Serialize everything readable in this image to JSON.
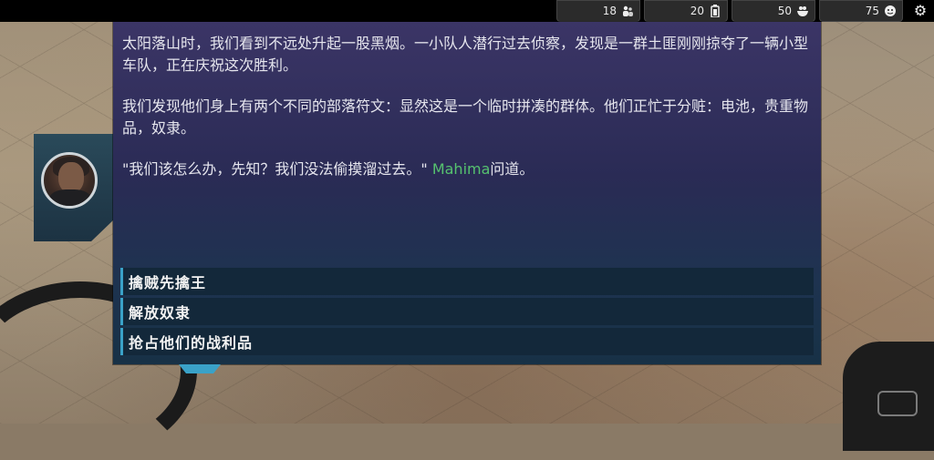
{
  "resources": [
    {
      "value": "18",
      "icon": "people-icon"
    },
    {
      "value": "20",
      "icon": "battery-icon"
    },
    {
      "value": "50",
      "icon": "food-bowl-icon"
    },
    {
      "value": "75",
      "icon": "morale-icon"
    }
  ],
  "story": {
    "paragraph1": "太阳落山时，我们看到不远处升起一股黑烟。一小队人潜行过去侦察，发现是一群土匪刚刚掠夺了一辆小型车队，正在庆祝这次胜利。",
    "paragraph2": "我们发现他们身上有两个不同的部落符文：显然这是一个临时拼凑的群体。他们正忙于分赃：电池，贵重物品，奴隶。",
    "quote_before": "\"我们该怎么办，先知？我们没法偷摸溜过去。\" ",
    "speaker": "Mahima",
    "quote_after": "问道。"
  },
  "choices": [
    {
      "label": "擒贼先擒王"
    },
    {
      "label": "解放奴隶"
    },
    {
      "label": "抢占他们的战利品"
    }
  ],
  "colors": {
    "speaker": "#56c26f",
    "choice_accent": "#3aa2c8"
  }
}
